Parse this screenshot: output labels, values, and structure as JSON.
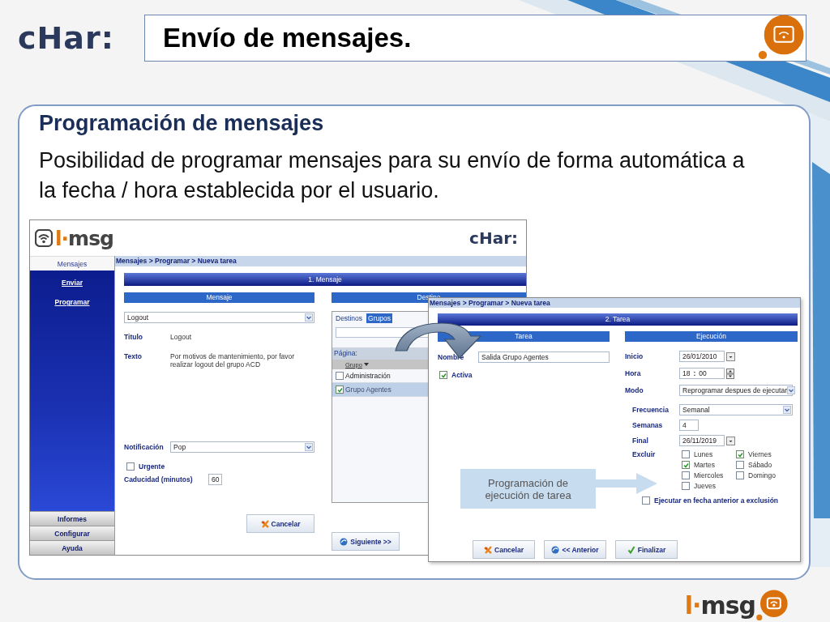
{
  "slide": {
    "logo": "cHar:",
    "title": "Envío de mensajes.",
    "heading": "Programación de mensajes",
    "body": "Posibilidad de programar mensajes para su envío de forma automática a la fecha / hora establecida por el usuario."
  },
  "screenshot_1": {
    "logo": "l·msg",
    "brand": "cHar:",
    "nav": [
      {
        "label": "Mensajes",
        "expanded": true,
        "links": [
          "Enviar",
          "Programar"
        ]
      },
      {
        "label": "Informes",
        "expanded": false
      },
      {
        "label": "Configurar",
        "expanded": false
      },
      {
        "label": "Ayuda",
        "expanded": false
      }
    ],
    "breadcrumb": "Mensajes > Programar > Nueva tarea",
    "step": "1. Mensaje",
    "message": {
      "header": "Mensaje",
      "template": "Logout",
      "fields": [
        {
          "label": "Titulo",
          "value": "Logout"
        },
        {
          "label": "Texto",
          "value": "Por motivos de mantenimiento, por favor realizar logout del grupo ACD"
        }
      ],
      "notification": {
        "label": "Notificación",
        "value": "Pop"
      },
      "urgent": {
        "label": "Urgente",
        "checked": false
      },
      "expiry": {
        "label": "Caducidad (minutos)",
        "value": "60"
      }
    },
    "destination": {
      "header": "Destino",
      "tabs": [
        {
          "label": "Destinos",
          "selected": false
        },
        {
          "label": "Grupos",
          "selected": true
        }
      ],
      "page_label": "Página:",
      "column": "Grupo",
      "rows": [
        {
          "label": "Administración",
          "checked": false,
          "selected": false
        },
        {
          "label": "Grupo Agentes",
          "checked": true,
          "selected": true
        }
      ]
    },
    "buttons": [
      {
        "kind": "cancel",
        "label": "Cancelar"
      },
      {
        "kind": "next",
        "label": "Siguiente >>"
      }
    ]
  },
  "screenshot_2": {
    "breadcrumb": "Mensajes > Programar > Nueva tarea",
    "step": "2. Tarea",
    "task": {
      "header": "Tarea",
      "name": {
        "label": "Nombre",
        "value": "Salida Grupo Agentes"
      },
      "active": {
        "label": "Activa",
        "checked": true
      }
    },
    "execution": {
      "header": "Ejecución",
      "start": {
        "label": "Inicio",
        "value": "26/01/2010"
      },
      "time": {
        "label": "Hora",
        "hour": "18",
        "separator": ":",
        "minute": "00"
      },
      "mode": {
        "label": "Modo",
        "value": "Reprogramar despues de ejecutar"
      },
      "frequency": {
        "label": "Frecuencia",
        "value": "Semanal"
      },
      "weeks": {
        "label": "Semanas",
        "value": "4"
      },
      "end": {
        "label": "Final",
        "value": "26/11/2019"
      },
      "exclude": {
        "label": "Excluir",
        "days": [
          {
            "label": "Lunes",
            "checked": false
          },
          {
            "label": "Viernes",
            "checked": true
          },
          {
            "label": "Martes",
            "checked": true
          },
          {
            "label": "Sábado",
            "checked": false
          },
          {
            "label": "Miercoles",
            "checked": false
          },
          {
            "label": "Domingo",
            "checked": false
          },
          {
            "label": "Jueves",
            "checked": false
          }
        ]
      },
      "run_before": {
        "label": "Ejecutar en fecha anterior a exclusión",
        "checked": false
      }
    },
    "buttons": [
      {
        "kind": "cancel",
        "label": "Cancelar"
      },
      {
        "kind": "back",
        "label": "<< Anterior"
      },
      {
        "kind": "finish",
        "label": "Finalizar"
      }
    ]
  },
  "callout": "Programación de ejecución de tarea",
  "footer_logo": "l·msg"
}
